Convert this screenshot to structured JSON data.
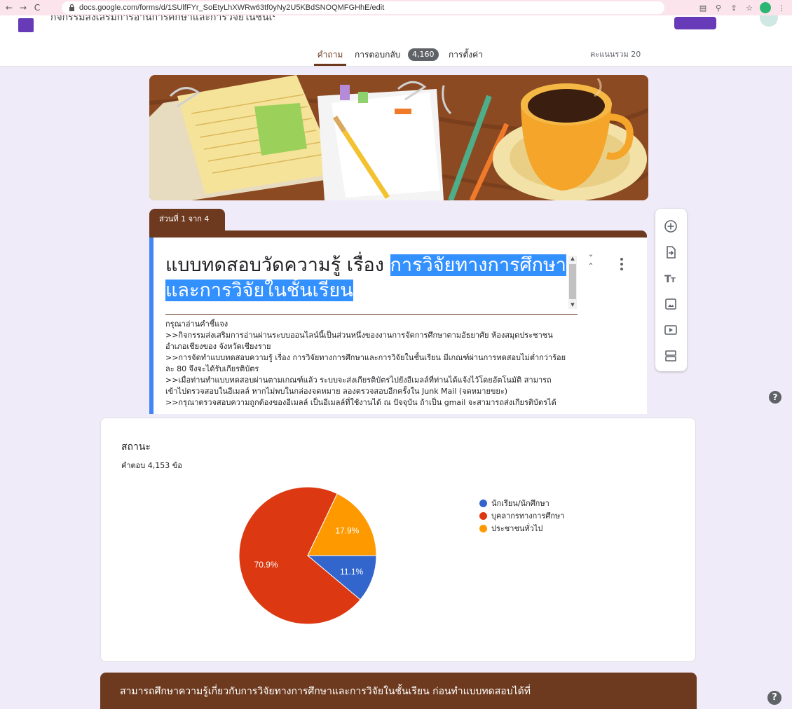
{
  "browser": {
    "url": "docs.google.com/forms/d/1SUlfFYr_SoEtyLhXWRw63tf0yNy2U5KBdSNOQMFGHhE/edit"
  },
  "header": {
    "doc_title": "กิจกรรมส่งเสริมการอ่านการศึกษาและการวิจัยในชั้นเรียน",
    "tabs": [
      {
        "label": "คำถาม"
      },
      {
        "label": "การตอบกลับ"
      },
      {
        "label": "การตั้งค่า"
      }
    ],
    "responses_badge": "4,160",
    "total_score": "คะแนนรวม 20"
  },
  "section": {
    "tab_label": "ส่วนที่ 1 จาก 4",
    "title_line1_plain": "แบบทดสอบวัดความรู้ เรื่อง ",
    "title_line1_highlight": "การวิจัยทางการศึกษา",
    "title_line2_highlight": "และการวิจัยในชั้นเรียน",
    "description": [
      "กรุณาอ่านคำชี้แจง",
      "    >>กิจกรรมส่งเสริมการอ่านผ่านระบบออนไลน์นี้เป็นส่วนหนึ่งของงานการจัดการศึกษาตามอัธยาศัย ห้องสมุดประชาชน",
      "อำเภอเชียงของ จังหวัดเชียงราย",
      "    >>การจัดทำแบบทดสอบความรู้ เรื่อง การวิจัยทางการศึกษาและการวิจัยในชั้นเรียน มีเกณฑ์ผ่านการทดสอบไม่ต่ำกว่าร้อย",
      "ละ 80 จึงจะได้รับเกียรติบัตร",
      "    >>เมื่อท่านทำแบบทดสอบผ่านตามเกณฑ์แล้ว ระบบจะส่งเกียรติบัตรไปยังอีเมลล์ที่ท่านได้แจ้งไว้โดยอัตโนมัติ สามารถ",
      "เข้าไปตรวจสอบในอีเมลล์ หากไม่พบในกล่องจดหมาย ลองตรวจสอบอีกครั้งใน Junk Mail (จดหมายขยะ)",
      "    >>กรุณาตรวจสอบความถูกต้องของอีเมลล์ เป็นอีเมลล์ที่ใช้งานได้ ณ ปัจจุบัน ถ้าเป็น gmail จะสามารถส่งเกียรติบัตรได้"
    ]
  },
  "chart_card": {
    "title": "สถานะ",
    "count": "คำตอบ 4,153 ข้อ"
  },
  "chart_data": {
    "type": "pie",
    "categories": [
      "นักเรียน/นักศึกษา",
      "บุคลากรทางการศึกษา",
      "ประชาชนทั่วไป"
    ],
    "values": [
      11.1,
      70.9,
      17.9
    ],
    "labels": [
      "11.1%",
      "70.9%",
      "17.9%"
    ],
    "colors": [
      "#3366cc",
      "#dc3912",
      "#ff9900"
    ],
    "legend_position": "right"
  },
  "bottom_section": {
    "text": "สามารถศึกษาความรู้เกี่ยวกับการวิจัยทางการศึกษาและการวิจัยในชั้นเรียน ก่อนทำแบบทดสอบได้ที่"
  },
  "icons": {
    "toolbar": [
      "add-question-icon",
      "import-questions-icon",
      "add-title-icon",
      "add-image-icon",
      "add-video-icon",
      "add-section-icon"
    ],
    "help": "help-icon"
  }
}
